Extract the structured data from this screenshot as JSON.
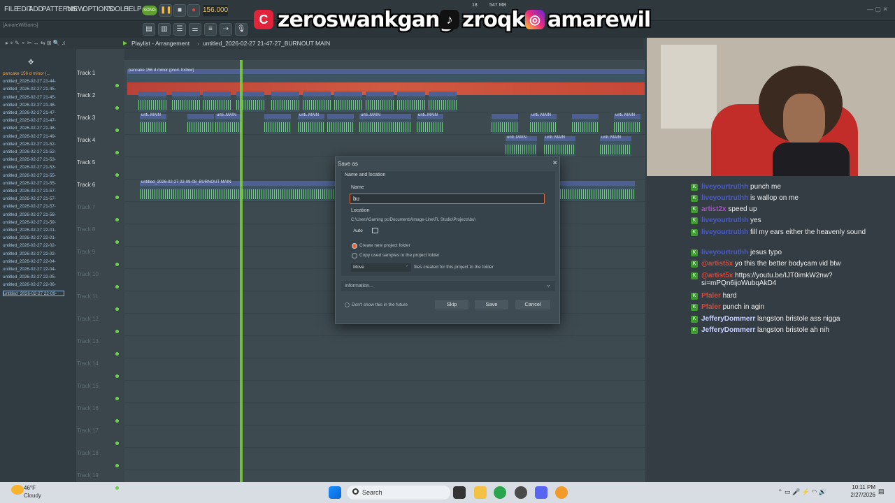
{
  "menu": {
    "items": [
      "FILE",
      "EDIT",
      "ADD",
      "PATTERNS",
      "VIEW",
      "OPTIONS",
      "TOOLS",
      "HELP"
    ],
    "song_label": "SONG",
    "bpm": "156.000",
    "time": "0:22:16",
    "cpu": "18",
    "ram": "547 MB"
  },
  "project_user": "[AmareWilliams]",
  "socials": {
    "twitch": "zeroswankgang",
    "tiktok": "zroqk",
    "instagram": "amarewil"
  },
  "playlist": {
    "title": "Playlist - Arrangement",
    "pattern": "untitled_2026-02-27 21-47-27_BURNOUT MAIN",
    "ruler": [
      "1",
      "3",
      "5",
      "7",
      "9",
      "11",
      "13",
      "15",
      "17",
      "19",
      "21",
      "23",
      "25",
      "27",
      "29",
      "31",
      "33",
      "35",
      "37",
      "39",
      "41",
      "43",
      "45",
      "47",
      "49",
      "51",
      "53",
      "55",
      "57",
      "59",
      "61",
      "63",
      "65"
    ]
  },
  "browser_items": [
    "pancake 156 d minor (...",
    "untitled_2026-02-27 21-44-",
    "untitled_2026-02-27 21-45-",
    "untitled_2026-02-27 21-45-",
    "untitled_2026-02-27 21-46-",
    "untitled_2026-02-27 21-47-",
    "untitled_2026-02-27 21-47-",
    "untitled_2026-02-27 21-48-",
    "untitled_2026-02-27 21-49-",
    "untitled_2026-02-27 21-52-",
    "untitled_2026-02-27 21-52-",
    "untitled_2026-02-27 21-53-",
    "untitled_2026-02-27 21-53-",
    "untitled_2026-02-27 21-55-",
    "untitled_2026-02-27 21-55-",
    "untitled_2026-02-27 21-57-",
    "untitled_2026-02-27 21-57-",
    "untitled_2026-02-27 21-57-",
    "untitled_2026-02-27 21-58-",
    "untitled_2026-02-27 21-59-",
    "untitled_2026-02-27 22-01-",
    "untitled_2026-02-27 22-01-",
    "untitled_2026-02-27 22-02-",
    "untitled_2026-02-27 22-02-",
    "untitled_2026-02-27 22-04-",
    "untitled_2026-02-27 22-04-",
    "untitled_2026-02-27 22-05-",
    "untitled_2026-02-27 22-06-",
    "untitled_2026-02-27 22-09-"
  ],
  "tracks": [
    "Track 1",
    "Track 2",
    "Track 3",
    "Track 4",
    "Track 5",
    "Track 6",
    "Track 7",
    "Track 8",
    "Track 9",
    "Track 10",
    "Track 11",
    "Track 12",
    "Track 13",
    "Track 14",
    "Track 15",
    "Track 16",
    "Track 17",
    "Track 18",
    "Track 19"
  ],
  "clips": {
    "track1": "pancake 156 d minor (prod. hxllxw)",
    "main": "unti..MAIN",
    "main_short": "unti..IN",
    "track6": "untitled_2026-02-27 22-09-08_BURNOUT MAIN"
  },
  "dialog": {
    "title": "Save as",
    "section": "Name and location",
    "name_label": "Name",
    "name_value": "bu",
    "location_label": "Location",
    "location_path": "C:\\Users\\Gaming pc\\Documents\\Image-Line\\FL Studio\\Projects\\bu\\",
    "auto_label": "Auto",
    "opt_create": "Create new project folder",
    "opt_copy": "Copy used samples to the project folder",
    "move_select": "Move",
    "move_desc": "files created for this project to the folder",
    "info": "Information...",
    "dont_show": "Don't show this in the future",
    "skip": "Skip",
    "save": "Save",
    "cancel": "Cancel"
  },
  "chat": [
    {
      "user": "liveyourtruthh",
      "text": "punch me"
    },
    {
      "user": "liveyourtruthh",
      "text": "is wallop on me"
    },
    {
      "user": "artist2x",
      "text": "speed up"
    },
    {
      "user": "liveyourtruthh",
      "text": "yes"
    },
    {
      "user": "liveyourtruthh",
      "text": "fill my ears either the heavenly sound"
    },
    {
      "user": "liveyourtruthh",
      "text": "jesus typo"
    },
    {
      "user": "@artist5x",
      "text": "yo this the better bodycam vid btw"
    },
    {
      "user": "@artist5x",
      "text": "https://youtu.be/IJT0imkW2nw?si=mPQn6ijoWubqAkD4"
    },
    {
      "user": "Pfaler",
      "text": "hard"
    },
    {
      "user": "Pfaler",
      "text": "punch in agin"
    },
    {
      "user": "JefferyDommerr",
      "text": "langston bristole ass nigga"
    },
    {
      "user": "JefferyDommerr",
      "text": "langston bristole ah nih"
    }
  ],
  "taskbar": {
    "weather_temp": "46°F",
    "weather_desc": "Cloudy",
    "search": "Search",
    "time": "10:11 PM",
    "date": "2/27/2026"
  }
}
